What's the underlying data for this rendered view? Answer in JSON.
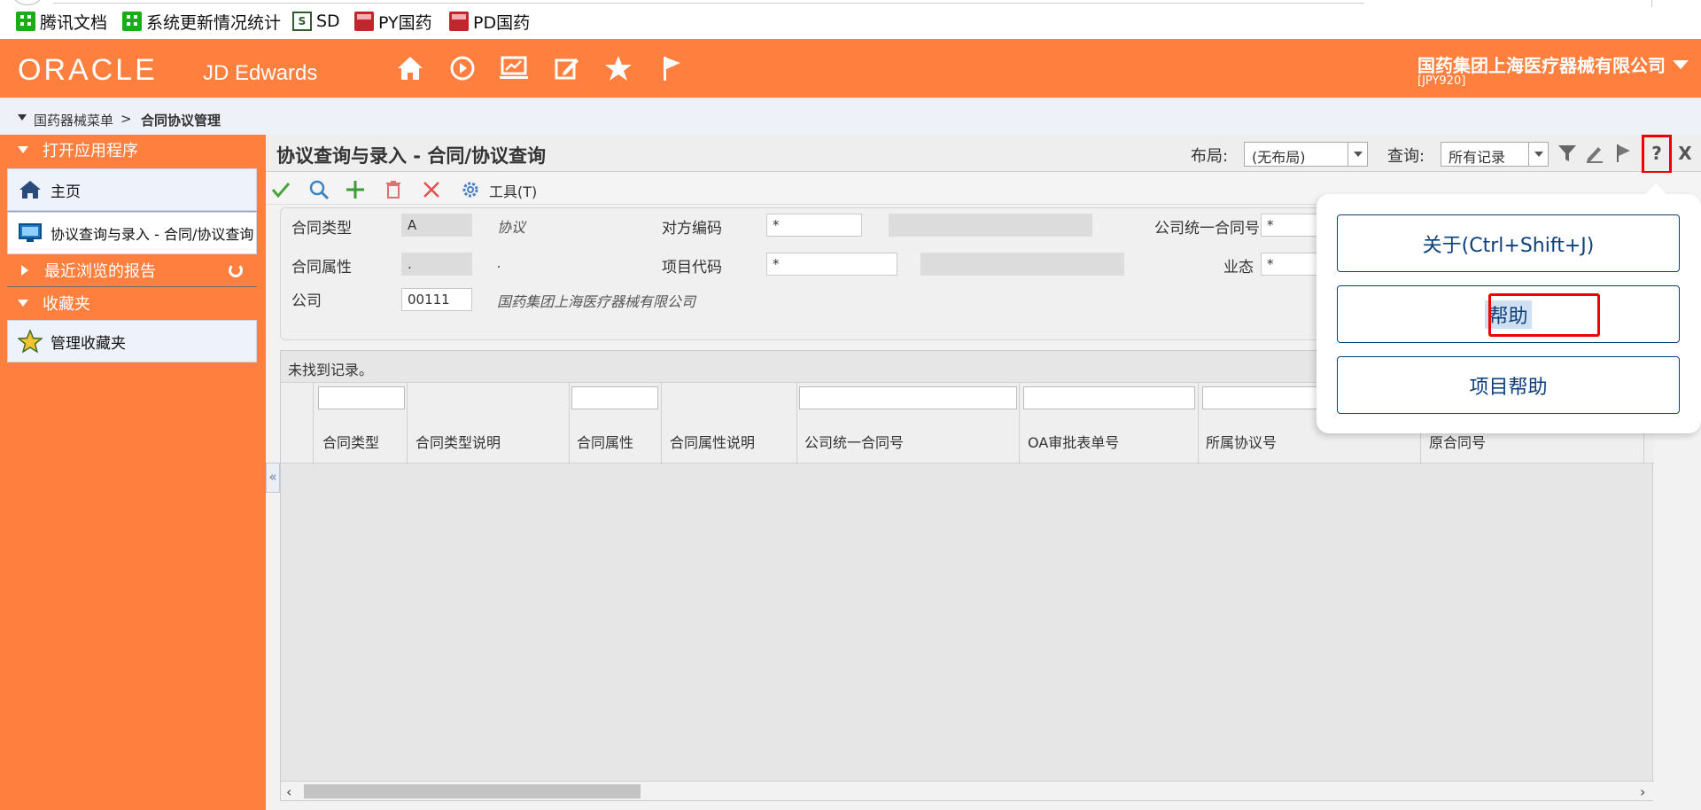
{
  "bookmarks": [
    {
      "label": "腾讯文档",
      "icon": "grid-icon"
    },
    {
      "label": "系统更新情况统计",
      "icon": "grid-icon"
    },
    {
      "label": "SD",
      "icon": "sd-icon"
    },
    {
      "label": "PY国药",
      "icon": "oracle-icon"
    },
    {
      "label": "PD国药",
      "icon": "oracle-icon"
    }
  ],
  "header": {
    "logo": "ORACLE",
    "logo_sub": "JD Edwards",
    "company": "国药集团上海医疗器械有限公司",
    "company_code": "[JPY920]"
  },
  "breadcrumb": {
    "menu": "国药器械菜单",
    "sep": ">",
    "current": "合同协议管理"
  },
  "sidebar": {
    "open_apps_title": "打开应用程序",
    "home_label": "主页",
    "current_app_label": "协议查询与录入 - 合同/协议查询",
    "recent_reports_title": "最近浏览的报告",
    "favorites_title": "收藏夹",
    "manage_favorites_label": "管理收藏夹"
  },
  "page": {
    "title": "协议查询与录入 - 合同/协议查询",
    "layout_label": "布局:",
    "layout_value": "(无布局)",
    "query_label": "查询:",
    "query_value": "所有记录",
    "tools_label": "工具(T)"
  },
  "filters": {
    "contract_type_label": "合同类型",
    "contract_type_value": "A",
    "contract_type_desc": "协议",
    "counterparty_label": "对方编码",
    "counterparty_value": "*",
    "company_contract_label": "公司统一合同号",
    "company_contract_value": "*",
    "contract_attr_label": "合同属性",
    "contract_attr_value": ".",
    "contract_attr_desc": ".",
    "project_code_label": "项目代码",
    "project_code_value": "*",
    "business_label": "业态",
    "business_value": "*",
    "company_label": "公司",
    "company_value": "00111",
    "company_desc": "国药集团上海医疗器械有限公司"
  },
  "grid": {
    "no_records": "未找到记录。",
    "columns": [
      "合同类型",
      "合同类型说明",
      "合同属性",
      "合同属性说明",
      "公司统一合同号",
      "OA审批表单号",
      "所属协议号",
      "原合同号"
    ]
  },
  "help_menu": {
    "about": "关于(Ctrl+Shift+J)",
    "help": "帮助",
    "item_help": "项目帮助"
  },
  "colors": {
    "brand_orange": "#ff7f3f",
    "highlight_red": "#e00000",
    "menu_blue": "#0d3f7c"
  }
}
